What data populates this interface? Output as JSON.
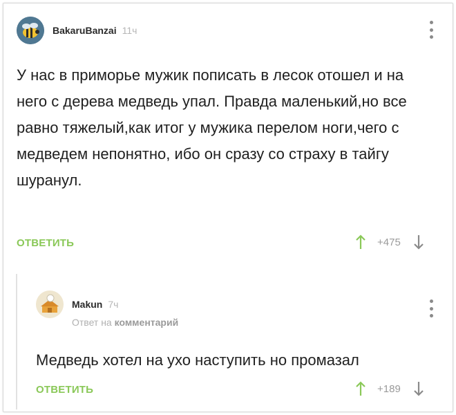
{
  "comments": [
    {
      "author": "BakaruBanzai",
      "time": "11ч",
      "text": "У нас в приморье мужик  пописать в лесок отошел и на него с дерева медведь упал. Правда маленький,но все равно тяжелый,как итог у мужика перелом ноги,чего с медведем непонятно, ибо он сразу со страху в тайгу шуранул.",
      "reply_label": "ОТВЕТИТЬ",
      "rating": "+475"
    },
    {
      "author": "Makun",
      "time": "7ч",
      "reply_prefix": "Ответ на",
      "reply_target": "комментарий",
      "text": "Медведь хотел на ухо наступить но промазал",
      "reply_label": "ОТВЕТИТЬ",
      "rating": "+189"
    }
  ],
  "icons": {
    "more": "more-vertical-icon",
    "up": "arrow-up-icon",
    "down": "arrow-down-icon"
  },
  "colors": {
    "accent_green": "#8ac858",
    "muted": "#9a9a9a"
  }
}
